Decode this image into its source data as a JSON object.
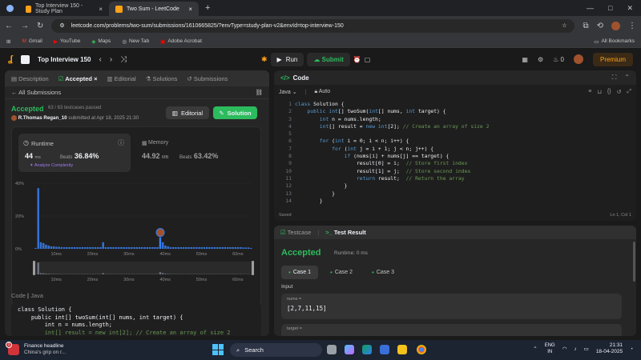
{
  "browser": {
    "tabs": [
      {
        "title": "Top Interview 150 - Study Plan",
        "active": false
      },
      {
        "title": "Two Sum - LeetCode",
        "active": true
      }
    ],
    "url": "leetcode.com/problems/two-sum/submissions/1610665825/?envType=study-plan-v2&envId=top-interview-150",
    "bookmarks": [
      "Gmail",
      "YouTube",
      "Maps",
      "New Tab",
      "Adobe Acrobat"
    ],
    "all_bookmarks": "All Bookmarks"
  },
  "lc_nav": {
    "title": "Top Interview 150",
    "run": "Run",
    "submit": "Submit",
    "streak": "0",
    "premium": "Premium"
  },
  "left": {
    "tabs": [
      "Description",
      "Accepted",
      "Editorial",
      "Solutions",
      "Submissions"
    ],
    "back": "All Submissions",
    "status": "Accepted",
    "testcases": "63 / 63 testcases passed",
    "user": "R.Thomas Regan_10",
    "submitted": "submitted at Apr 18, 2025 21:30",
    "editorial_btn": "Editorial",
    "solution_btn": "Solution",
    "runtime_label": "Runtime",
    "runtime_value": "44",
    "runtime_unit": "ms",
    "beats_label": "Beats",
    "runtime_beats": "36.84%",
    "analyze": "Analyze Complexity",
    "memory_label": "Memory",
    "memory_value": "44.92",
    "memory_unit": "MB",
    "memory_beats": "63.42%",
    "code_label": "Code",
    "code_lang": "Java",
    "snippet": [
      "class Solution {",
      "    public int[] twoSum(int[] nums, int target) {",
      "        int n = nums.length;",
      "        int[] result = new int[2]; // Create an array of size 2"
    ]
  },
  "chart_data": {
    "type": "bar",
    "y_ticks": [
      "40%",
      "20%",
      "0%"
    ],
    "ylim": [
      0,
      40
    ],
    "x_ticks": [
      "10ms",
      "20ms",
      "30ms",
      "40ms",
      "50ms",
      "60ms"
    ],
    "values": [
      0.5,
      37,
      4,
      3.5,
      2.5,
      2,
      1.5,
      1.5,
      1.2,
      1.2,
      1,
      1,
      1,
      1,
      1,
      1,
      1,
      1,
      1,
      1,
      1,
      1,
      1,
      1,
      1,
      1,
      4,
      1,
      1,
      1,
      1,
      1,
      1,
      1,
      1,
      1,
      1,
      1,
      1,
      1,
      1,
      1,
      1,
      1,
      1,
      1,
      1,
      1,
      7,
      4,
      2,
      1.5,
      1,
      1,
      1,
      1,
      1,
      1,
      1,
      1,
      1,
      1,
      1,
      1,
      1,
      1,
      1,
      1,
      1,
      1,
      1,
      1,
      1,
      1,
      1,
      1,
      1,
      1,
      1,
      1,
      0.8,
      0.8,
      0.8,
      0.5
    ],
    "highlight_index": 48
  },
  "editor": {
    "title": "Code",
    "lang": "Java",
    "auto": "Auto",
    "lines": [
      "class Solution {",
      "    public int[] twoSum(int[] nums, int target) {",
      "        int n = nums.length;",
      "        int[] result = new int[2]; // Create an array of size 2",
      "",
      "        for (int i = 0; i < n; i++) {",
      "            for (int j = i + 1; j < n; j++) {",
      "                if (nums[i] + nums[j] == target) {",
      "                    result[0] = i;  // Store first index",
      "                    result[1] = j;  // Store second index",
      "                    return result;  // Return the array",
      "                }",
      "            }",
      "        }"
    ],
    "saved": "Saved",
    "cursor": "Ln 1, Col 1"
  },
  "test": {
    "tab1": "Testcase",
    "tab2": "Test Result",
    "status": "Accepted",
    "runtime": "Runtime: 0 ms",
    "cases": [
      "Case 1",
      "Case 2",
      "Case 3"
    ],
    "input_label": "Input",
    "nums_label": "nums =",
    "nums_value": "[2,7,11,15]",
    "target_label": "target ="
  },
  "taskbar": {
    "notif": "1",
    "weather_title": "Finance headline",
    "weather_sub": "China's grip on r...",
    "search": "Search",
    "lang1": "ENG",
    "lang2": "IN",
    "time": "21:31",
    "date": "18-04-2025"
  },
  "colors": {
    "accent": "#2cbb5d",
    "brand": "#ffa116",
    "bars": "#3b82f6",
    "bg": "#1a1a1a"
  }
}
